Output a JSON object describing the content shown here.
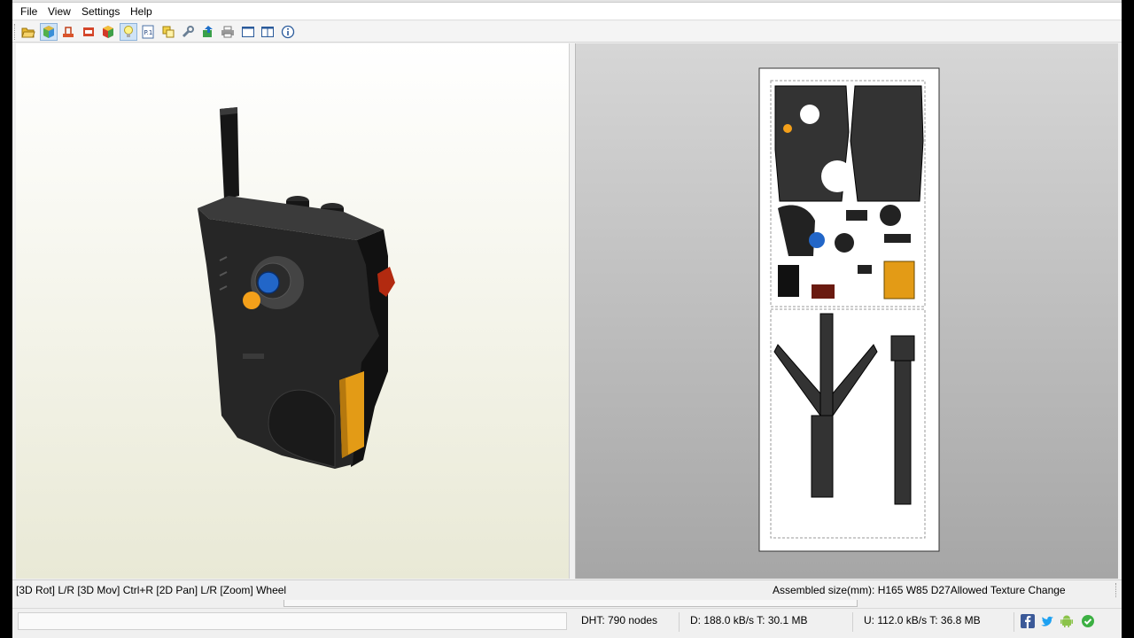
{
  "menu": [
    "File",
    "View",
    "Settings",
    "Help"
  ],
  "toolbar_icons": [
    "open-folder-icon",
    "3d-cube-icon",
    "unfold-icon",
    "print-icon",
    "texture-cube-icon",
    "lightbulb-icon",
    "page-number-icon",
    "copy-pieces-icon",
    "wrench-icon",
    "export-icon",
    "printer-icon",
    "single-pane-icon",
    "dual-pane-icon",
    "info-icon"
  ],
  "status": {
    "left": "[3D Rot] L/R [3D Mov] Ctrl+R [2D Pan] L/R [Zoom] Wheel",
    "right": "Assembled size(mm): H165 W85 D27Allowed Texture Change"
  },
  "bottom": {
    "dht": "DHT: 790 nodes",
    "download": "D: 188.0 kB/s T: 30.1 MB",
    "upload": "U: 112.0 kB/s T: 36.8 MB"
  },
  "bottom_icons": [
    "facebook-icon",
    "twitter-icon",
    "android-icon",
    "status-ok-icon"
  ]
}
